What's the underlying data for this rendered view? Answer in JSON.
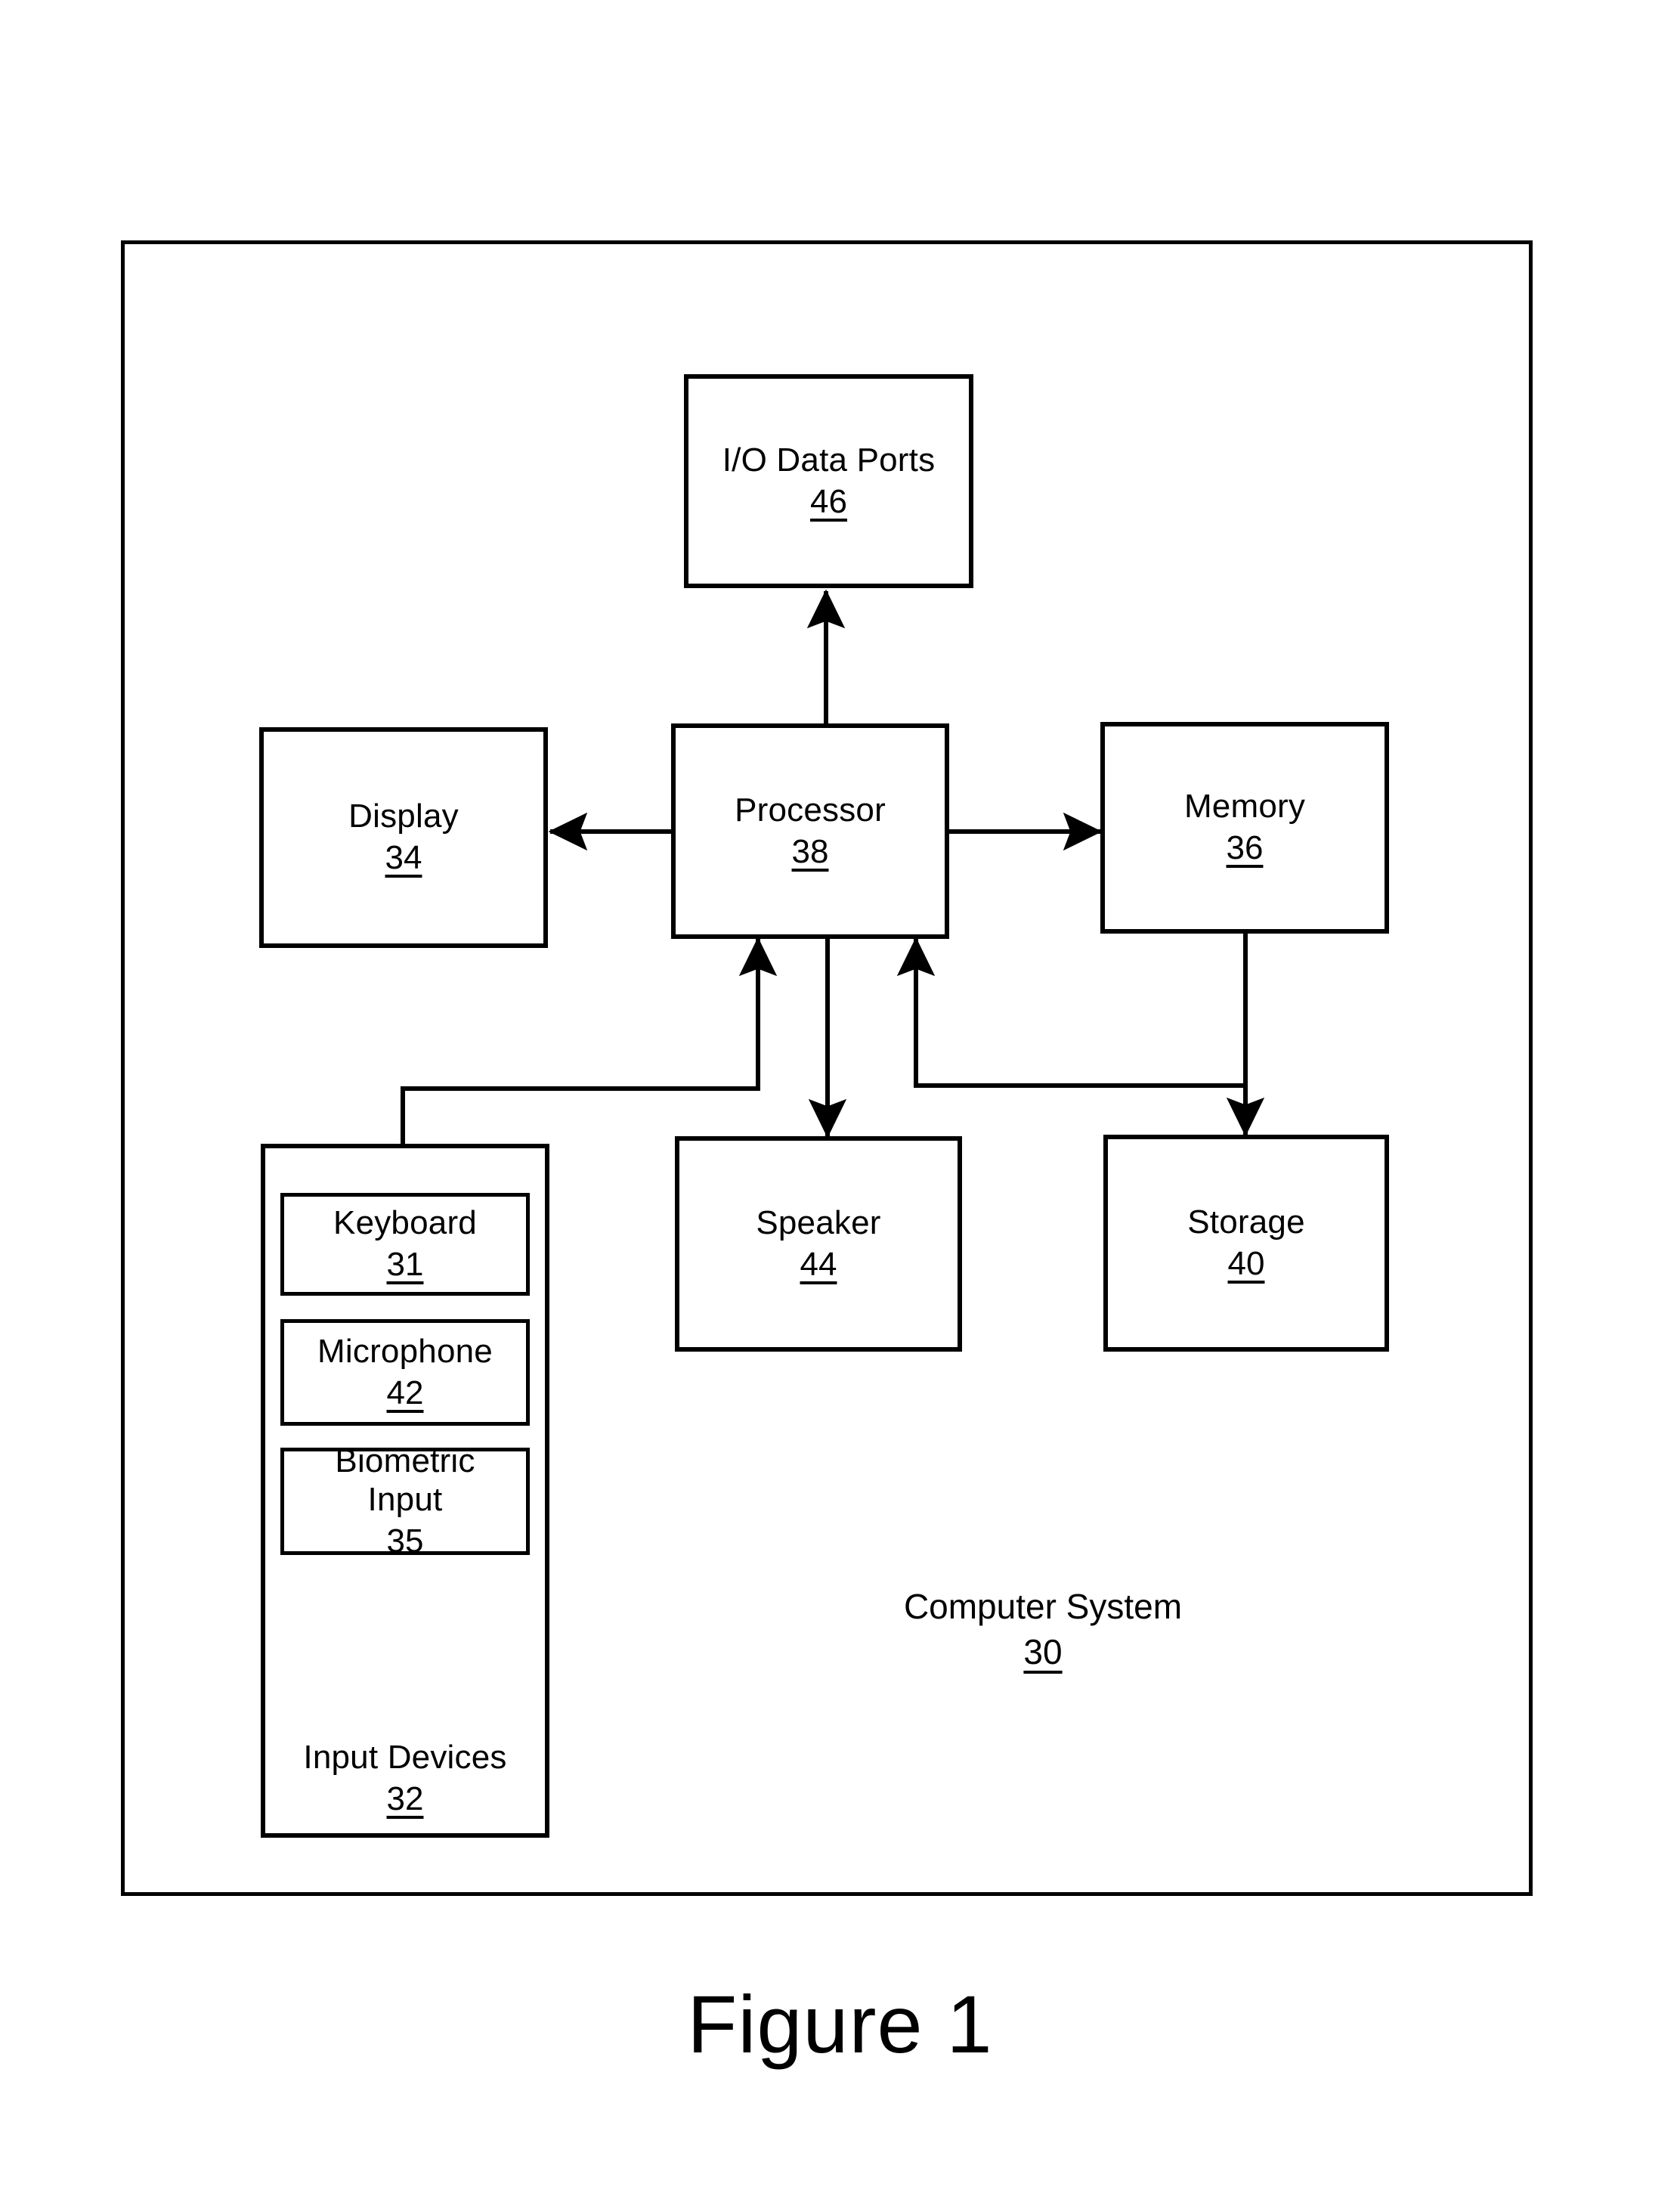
{
  "figure": {
    "caption": "Figure 1"
  },
  "system": {
    "label": "Computer System",
    "number": "30"
  },
  "blocks": [
    {
      "id": "io_data_ports",
      "label": "I/O Data Ports",
      "number": "46",
      "number_underlined": true
    },
    {
      "id": "display",
      "label": "Display",
      "number": "34",
      "number_underlined": true
    },
    {
      "id": "processor",
      "label": "Processor",
      "number": "38",
      "number_underlined": true
    },
    {
      "id": "memory",
      "label": "Memory",
      "number": "36",
      "number_underlined": true
    },
    {
      "id": "speaker",
      "label": "Speaker",
      "number": "44",
      "number_underlined": true
    },
    {
      "id": "storage",
      "label": "Storage",
      "number": "40",
      "number_underlined": true
    },
    {
      "id": "keyboard",
      "label": "Keyboard",
      "number": "31",
      "number_underlined": true
    },
    {
      "id": "microphone",
      "label": "Microphone",
      "number": "42",
      "number_underlined": true
    },
    {
      "id": "biometric_input",
      "label": "Biometric\nInput",
      "number": "35",
      "number_underlined": false
    },
    {
      "id": "input_devices",
      "label": "Input Devices",
      "number": "32",
      "number_underlined": true
    }
  ],
  "connections": [
    {
      "id": "processor-io",
      "from": "processor",
      "to": "io_data_ports",
      "arrow": "double",
      "orientation": "vertical"
    },
    {
      "id": "processor-display",
      "from": "processor",
      "to": "display",
      "arrow": "single",
      "orientation": "horizontal"
    },
    {
      "id": "processor-memory",
      "from": "processor",
      "to": "memory",
      "arrow": "double",
      "orientation": "horizontal"
    },
    {
      "id": "processor-speaker",
      "from": "processor",
      "to": "speaker",
      "arrow": "single",
      "orientation": "vertical"
    },
    {
      "id": "inputdevices-processor",
      "from": "input_devices",
      "to": "processor",
      "arrow": "single",
      "orientation": "elbow"
    },
    {
      "id": "storage-processor",
      "from": "storage",
      "to": "processor",
      "arrow": "single",
      "orientation": "elbow"
    },
    {
      "id": "memory-storage",
      "from": "memory",
      "to": "storage",
      "arrow": "single",
      "orientation": "vertical"
    }
  ],
  "colors": {
    "line": "#000000",
    "background": "#ffffff"
  }
}
